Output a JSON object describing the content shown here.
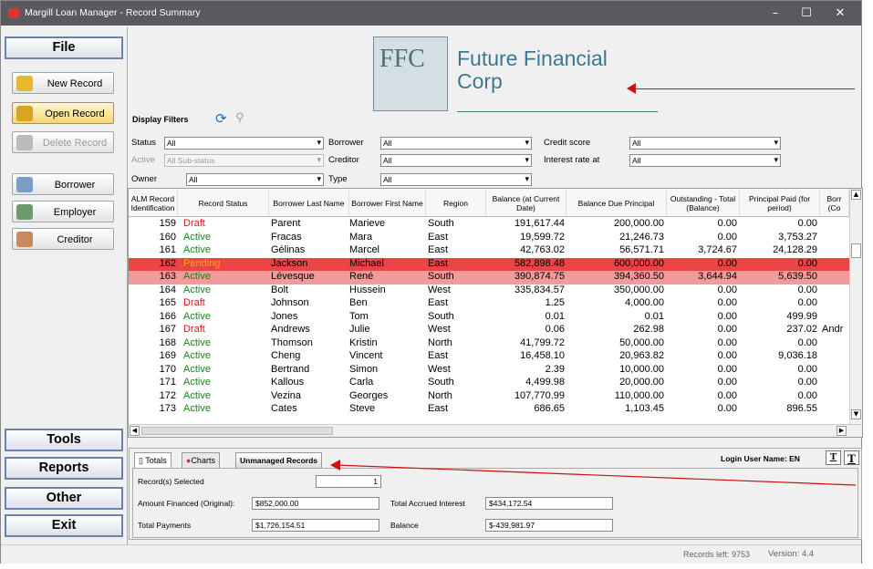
{
  "window": {
    "title": "Margill Loan Manager - Record Summary",
    "minimize": "–",
    "maximize": "☐",
    "close": "✕"
  },
  "sidebar": {
    "file": "File",
    "buttons": [
      {
        "label": "New Record",
        "icon": "new-record-icon"
      },
      {
        "label": "Open Record",
        "icon": "open-record-icon"
      },
      {
        "label": "Delete Record",
        "icon": "delete-record-icon"
      },
      {
        "label": "Borrower",
        "icon": "borrower-icon"
      },
      {
        "label": "Employer",
        "icon": "employer-icon"
      },
      {
        "label": "Creditor",
        "icon": "creditor-icon"
      }
    ],
    "tools": "Tools",
    "reports": "Reports",
    "other": "Other",
    "exit": "Exit"
  },
  "logo": {
    "letters": "FFC",
    "name_line1": "Future Financial",
    "name_line2": "Corp"
  },
  "filters": {
    "title": "Display Filters",
    "status_label": "Status",
    "status_value": "All",
    "active_label": "Active",
    "active_value": "All Sub-status",
    "owner_label": "Owner",
    "owner_value": "All",
    "borrower_label": "Borrower",
    "borrower_value": "All",
    "creditor_label": "Creditor",
    "creditor_value": "All",
    "type_label": "Type",
    "type_value": "All",
    "credit_label": "Credit score",
    "credit_value": "All",
    "interest_label": "Interest rate at",
    "interest_value": "All"
  },
  "grid": {
    "headers": [
      "ALM Record Identification",
      "Record Status",
      "Borrower Last Name",
      "Borrower First Name",
      "Region",
      "Balance (at Current Date)",
      "Balance Due Principal",
      "Outstanding - Total (Balance)",
      "Principal Paid (for period)",
      "Borr (Co"
    ],
    "rows": [
      {
        "id": "159",
        "status": "Draft",
        "last": "Parent",
        "first": "Marieve",
        "region": "South",
        "bal": "191,617.44",
        "princ": "200,000.00",
        "out": "0.00",
        "paid": "0.00",
        "extra": ""
      },
      {
        "id": "160",
        "status": "Active",
        "last": "Fracas",
        "first": "Mara",
        "region": "East",
        "bal": "19,599.72",
        "princ": "21,246.73",
        "out": "0.00",
        "paid": "3,753.27",
        "extra": ""
      },
      {
        "id": "161",
        "status": "Active",
        "last": "Gélinas",
        "first": "Marcel",
        "region": "East",
        "bal": "42,763.02",
        "princ": "56,571.71",
        "out": "3,724.67",
        "paid": "24,128.29",
        "extra": ""
      },
      {
        "id": "162",
        "status": "Pending",
        "last": "Jackson",
        "first": "Michael",
        "region": "East",
        "bal": "582,898.48",
        "princ": "600,000.00",
        "out": "0.00",
        "paid": "0.00",
        "extra": ""
      },
      {
        "id": "163",
        "status": "Active",
        "last": "Lévesque",
        "first": "René",
        "region": "South",
        "bal": "390,874.75",
        "princ": "394,360.50",
        "out": "3,644.94",
        "paid": "5,639.50",
        "extra": ""
      },
      {
        "id": "164",
        "status": "Active",
        "last": "Bolt",
        "first": "Hussein",
        "region": "West",
        "bal": "335,834.57",
        "princ": "350,000.00",
        "out": "0.00",
        "paid": "0.00",
        "extra": ""
      },
      {
        "id": "165",
        "status": "Draft",
        "last": "Johnson",
        "first": "Ben",
        "region": "East",
        "bal": "1.25",
        "princ": "4,000.00",
        "out": "0.00",
        "paid": "0.00",
        "extra": ""
      },
      {
        "id": "166",
        "status": "Active",
        "last": "Jones",
        "first": "Tom",
        "region": "South",
        "bal": "0.01",
        "princ": "0.01",
        "out": "0.00",
        "paid": "499.99",
        "extra": ""
      },
      {
        "id": "167",
        "status": "Draft",
        "last": "Andrews",
        "first": "Julie",
        "region": "West",
        "bal": "0.06",
        "princ": "262.98",
        "out": "0.00",
        "paid": "237.02",
        "extra": "Andr"
      },
      {
        "id": "168",
        "status": "Active",
        "last": "Thomson",
        "first": "Kristin",
        "region": "North",
        "bal": "41,799.72",
        "princ": "50,000.00",
        "out": "0.00",
        "paid": "0.00",
        "extra": ""
      },
      {
        "id": "169",
        "status": "Active",
        "last": "Cheng",
        "first": "Vincent",
        "region": "East",
        "bal": "16,458.10",
        "princ": "20,963.82",
        "out": "0.00",
        "paid": "9,036.18",
        "extra": ""
      },
      {
        "id": "170",
        "status": "Active",
        "last": "Bertrand",
        "first": "Simon",
        "region": "West",
        "bal": "2.39",
        "princ": "10,000.00",
        "out": "0.00",
        "paid": "0.00",
        "extra": ""
      },
      {
        "id": "171",
        "status": "Active",
        "last": "Kallous",
        "first": "Carla",
        "region": "South",
        "bal": "4,499.98",
        "princ": "20,000.00",
        "out": "0.00",
        "paid": "0.00",
        "extra": ""
      },
      {
        "id": "172",
        "status": "Active",
        "last": "Vezina",
        "first": "Georges",
        "region": "North",
        "bal": "107,770.99",
        "princ": "110,000.00",
        "out": "0.00",
        "paid": "0.00",
        "extra": ""
      },
      {
        "id": "173",
        "status": "Active",
        "last": "Cates",
        "first": "Steve",
        "region": "East",
        "bal": "686.65",
        "princ": "1,103.45",
        "out": "0.00",
        "paid": "896.55",
        "extra": ""
      }
    ]
  },
  "bottom": {
    "tab_totals": "Totals",
    "tab_charts": "Charts",
    "unmanaged": "Unmanaged Records",
    "login": "Login User Name: EN",
    "t1": "T",
    "t2": "T",
    "selected_label": "Record(s) Selected",
    "selected_value": "1",
    "financed_label": "Amount Financed (Original):",
    "financed_value": "$852,000.00",
    "accrued_label": "Total Accrued Interest",
    "accrued_value": "$434,172.54",
    "payments_label": "Total Payments",
    "payments_value": "$1,726,154.51",
    "balance_label": "Balance",
    "balance_value": "$-439,981.97"
  },
  "status": {
    "records_left": "Records left: 9753",
    "version": "Version: 4.4"
  },
  "colors": {
    "pending_row": "#ea4545",
    "selected_row": "#f39b9b",
    "annotation": "#cc1111"
  }
}
